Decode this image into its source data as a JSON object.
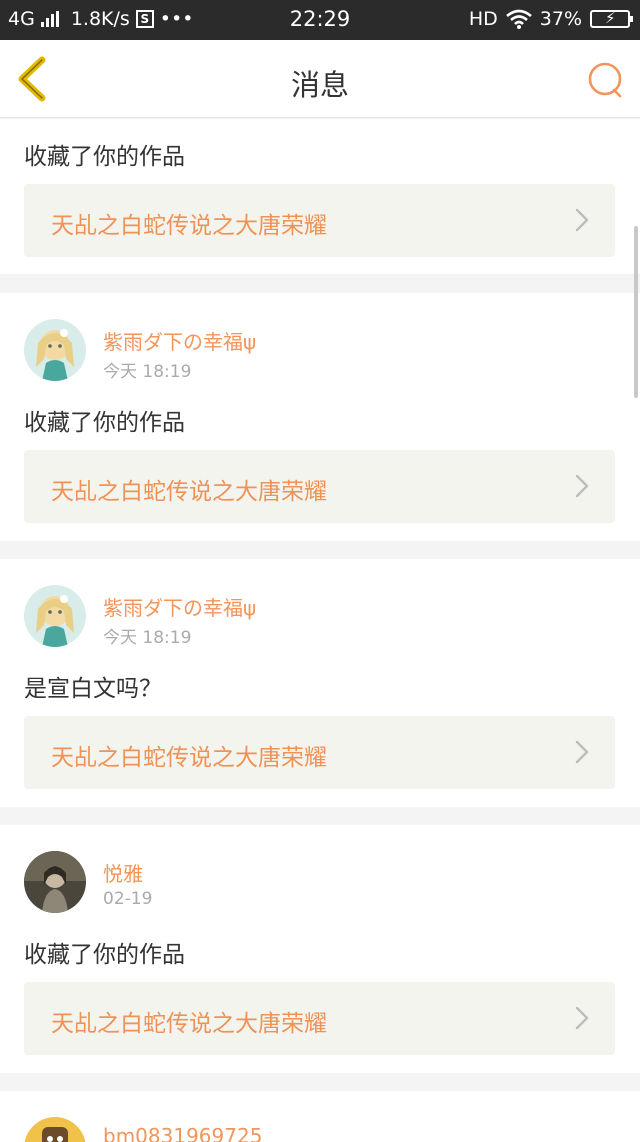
{
  "status_bar": {
    "network": "4G",
    "speed": "1.8K/s",
    "dots": "•••",
    "time": "22:29",
    "hd": "HD",
    "battery": "37%"
  },
  "header": {
    "title": "消息"
  },
  "colors": {
    "accent": "#f1955a",
    "back_arrow": "#e2b800",
    "search_icon": "#f1955a"
  },
  "items": [
    {
      "message": "收藏了你的作品",
      "work_title": "天乩之白蛇传说之大唐荣耀"
    },
    {
      "username": "紫雨ダ下の幸福ψ",
      "time": "今天 18:19",
      "message": "收藏了你的作品",
      "work_title": "天乩之白蛇传说之大唐荣耀",
      "avatar": "anime-girl-avatar"
    },
    {
      "username": "紫雨ダ下の幸福ψ",
      "time": "今天 18:19",
      "message": "是宣白文吗？",
      "work_title": "天乩之白蛇传说之大唐荣耀",
      "avatar": "anime-girl-avatar"
    },
    {
      "username": "悦雅",
      "time": "02-19",
      "message": "收藏了你的作品",
      "work_title": "天乩之白蛇传说之大唐荣耀",
      "avatar": "photo-avatar"
    },
    {
      "username": "bm0831969725",
      "avatar": "cartoon-avatar"
    }
  ]
}
